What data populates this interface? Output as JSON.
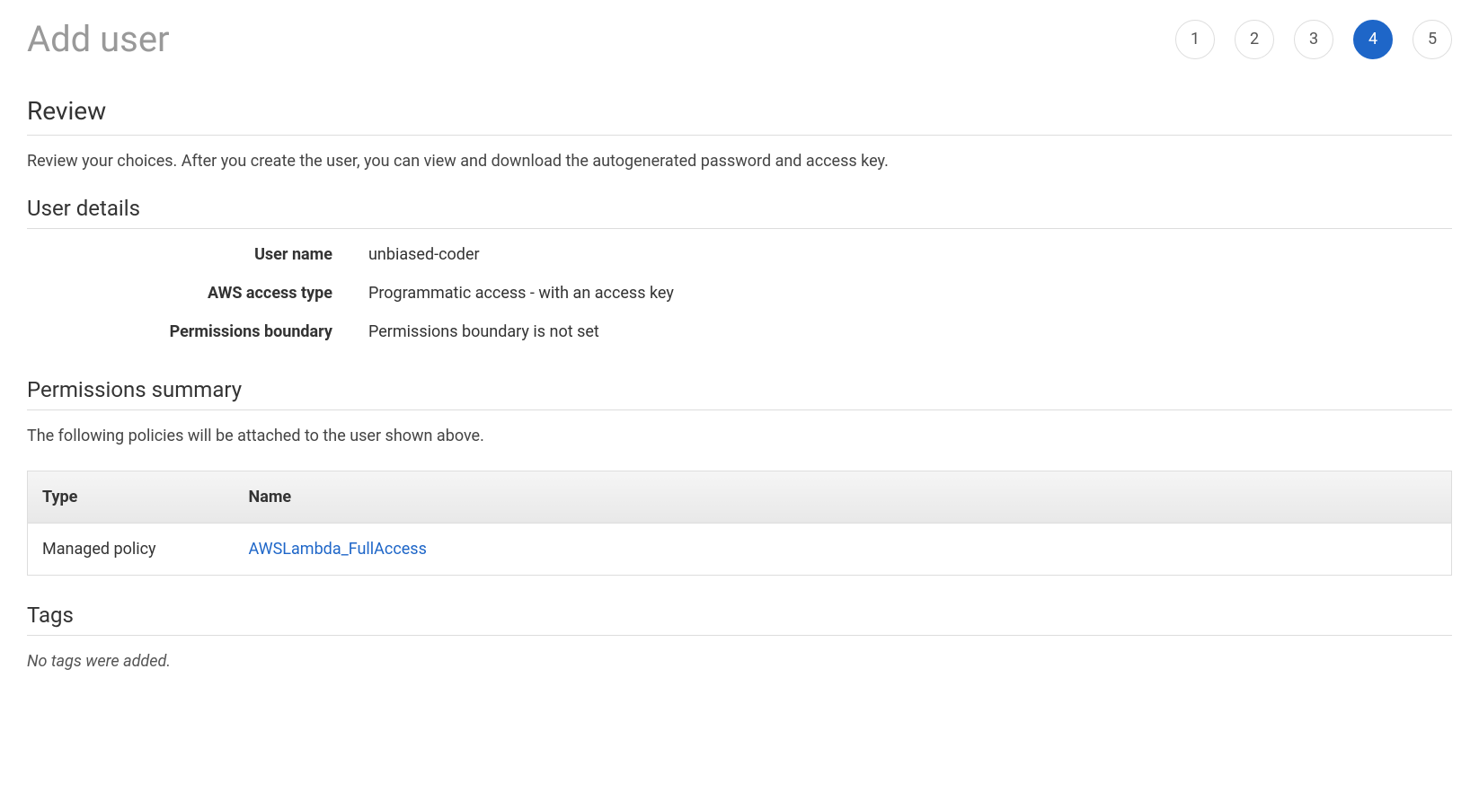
{
  "header": {
    "title": "Add user",
    "steps": [
      "1",
      "2",
      "3",
      "4",
      "5"
    ],
    "active_step_index": 3
  },
  "review": {
    "heading": "Review",
    "description": "Review your choices. After you create the user, you can view and download the autogenerated password and access key."
  },
  "user_details": {
    "heading": "User details",
    "rows": [
      {
        "label": "User name",
        "value": "unbiased-coder"
      },
      {
        "label": "AWS access type",
        "value": "Programmatic access - with an access key"
      },
      {
        "label": "Permissions boundary",
        "value": "Permissions boundary is not set"
      }
    ]
  },
  "permissions_summary": {
    "heading": "Permissions summary",
    "description": "The following policies will be attached to the user shown above.",
    "columns": {
      "type": "Type",
      "name": "Name"
    },
    "policies": [
      {
        "type": "Managed policy",
        "name": "AWSLambda_FullAccess"
      }
    ]
  },
  "tags": {
    "heading": "Tags",
    "empty_text": "No tags were added."
  }
}
